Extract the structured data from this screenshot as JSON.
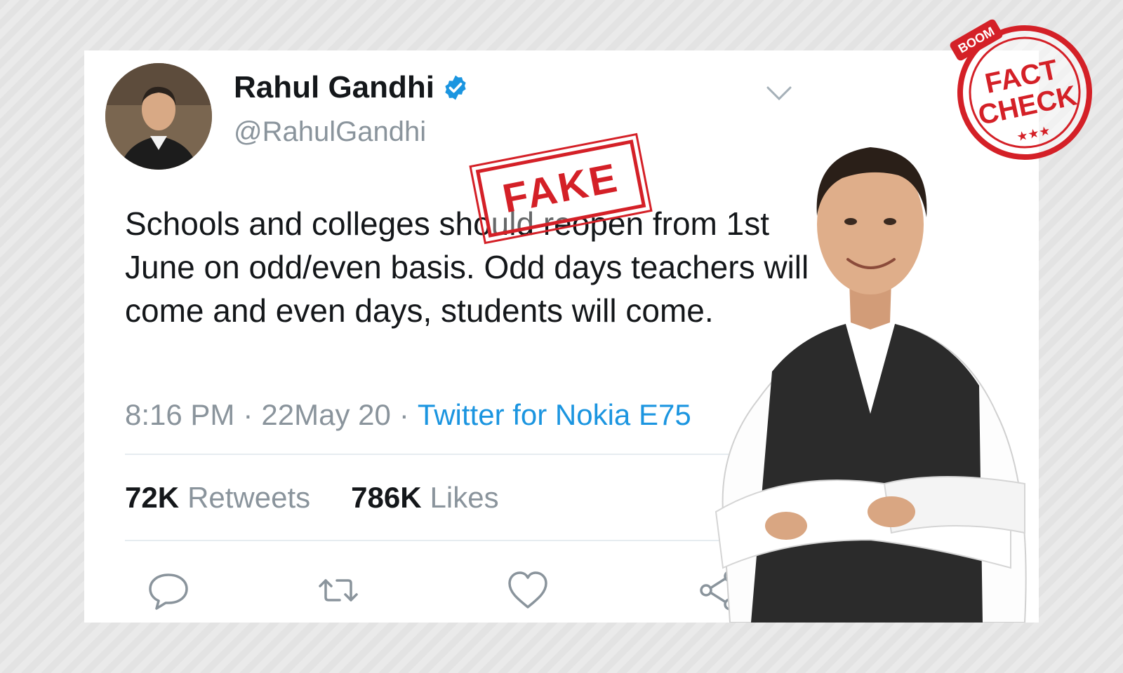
{
  "tweet": {
    "author_name": "Rahul Gandhi",
    "author_handle": "@RahulGandhi",
    "text": "Schools and colleges should reopen from 1st June on odd/even basis. Odd days teachers will come and even days, students will come.",
    "time": "8:16 PM",
    "date": "22May 20",
    "source": "Twitter for Nokia E75",
    "retweets_count": "72K",
    "retweets_label": "Retweets",
    "likes_count": "786K",
    "likes_label": "Likes"
  },
  "stamps": {
    "fake_label": "FAKE",
    "fact_check_brand": "BOOM",
    "fact_check_line1": "FACT",
    "fact_check_line2": "CHECK"
  },
  "icons": [
    "verified-badge-icon",
    "chevron-down-icon",
    "reply-icon",
    "retweet-icon",
    "like-icon",
    "share-icon"
  ],
  "colors": {
    "accent": "#1b95e0",
    "stamp_red": "#d42027",
    "text_primary": "#14171a",
    "text_secondary": "#8a949c"
  }
}
